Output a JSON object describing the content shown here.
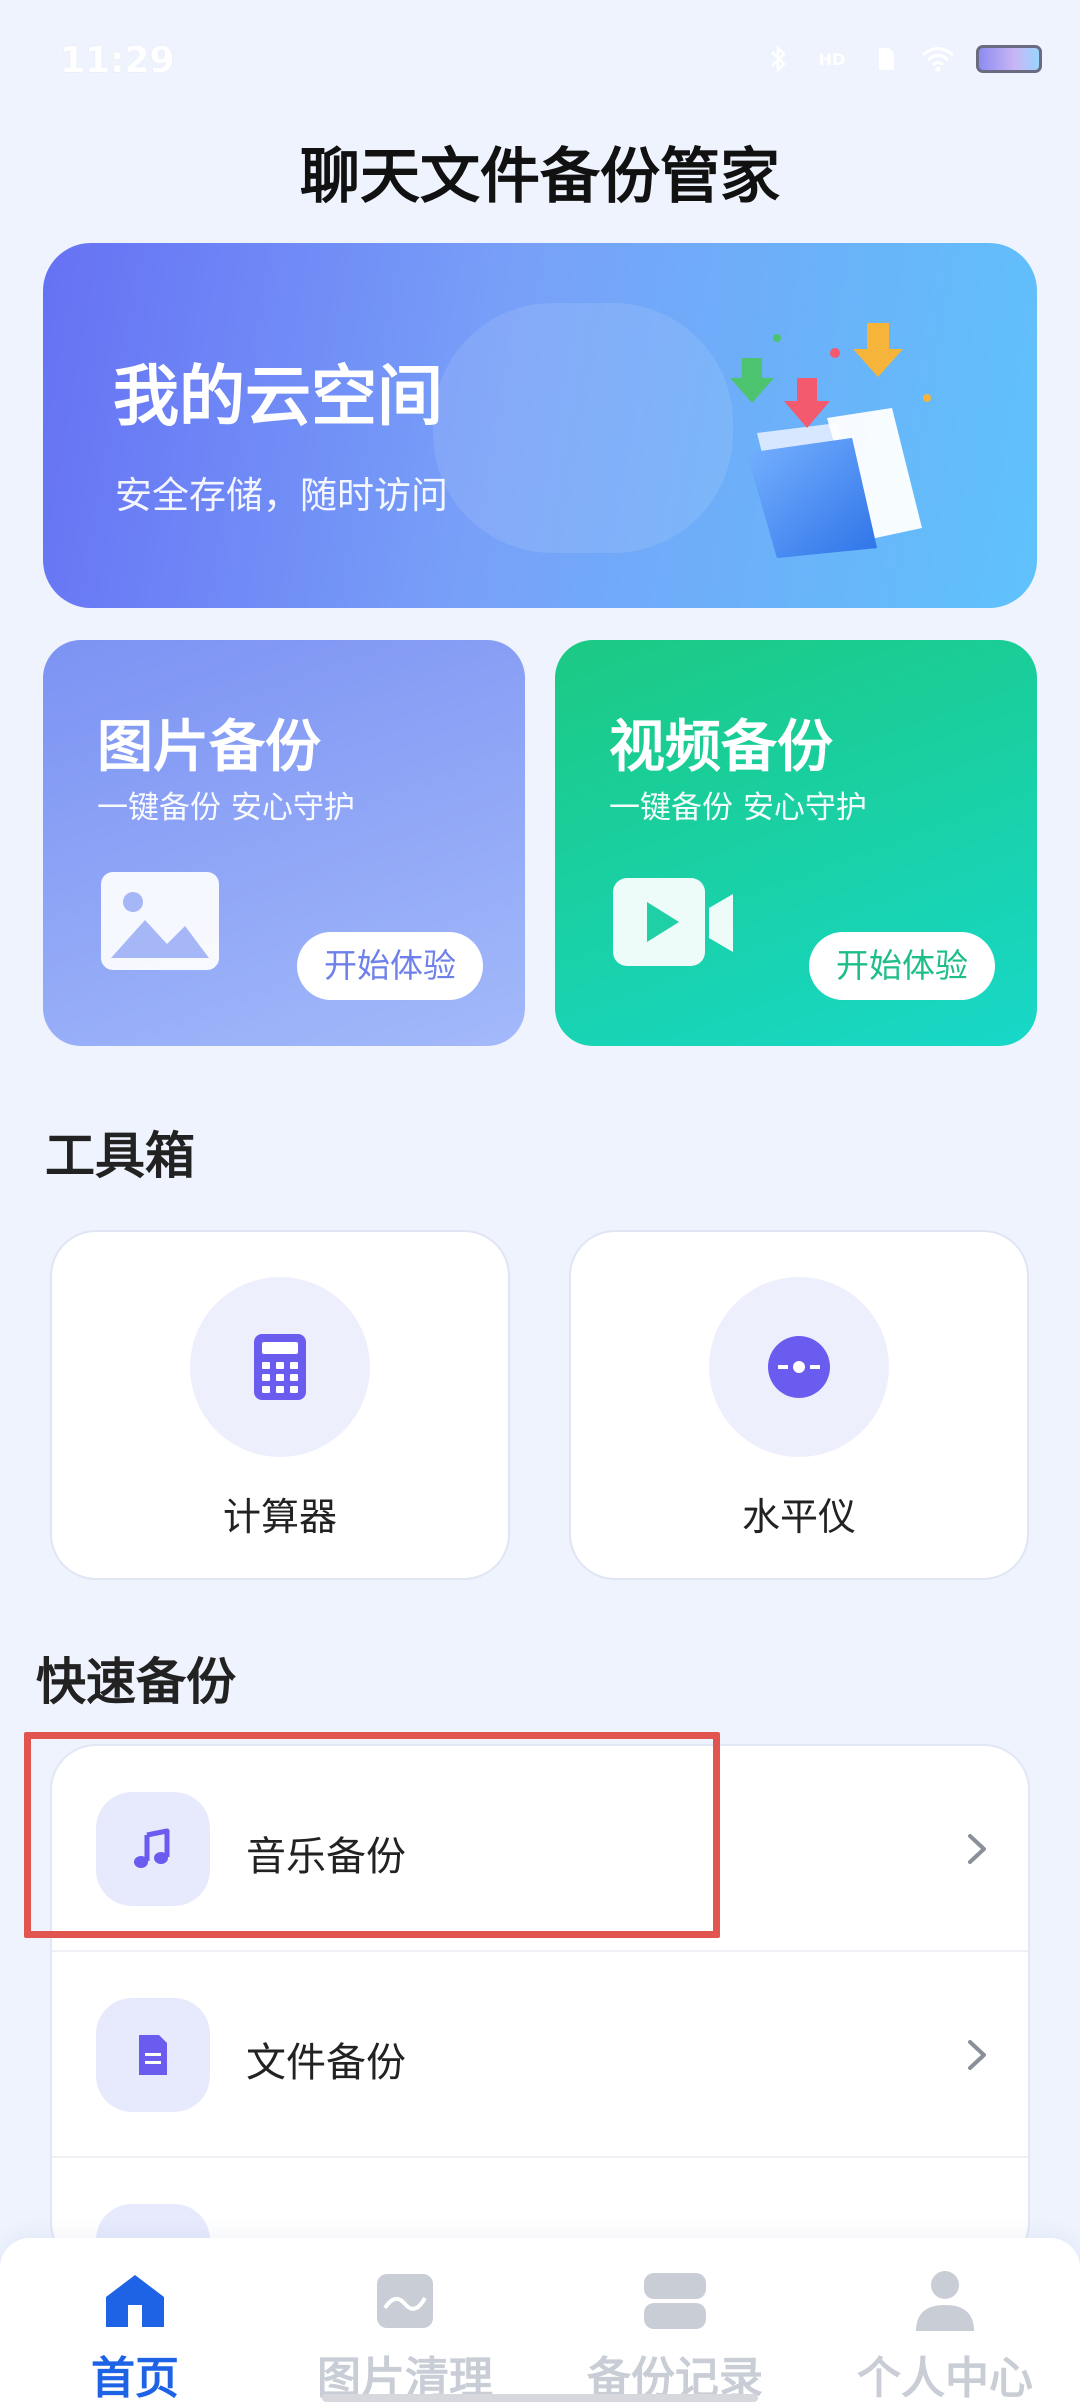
{
  "status_bar": {
    "time": "11:29",
    "network_label": "HD",
    "colors": {
      "time": "#ffffff"
    }
  },
  "app": {
    "title": "聊天文件备份管家"
  },
  "banner": {
    "title": "我的云空间",
    "subtitle": "安全存储，随时访问",
    "icon": "folder-download-icon"
  },
  "feature_cards": [
    {
      "title": "图片备份",
      "subtitle": "一键备份 安心守护",
      "button": "开始体验",
      "icon": "image-icon"
    },
    {
      "title": "视频备份",
      "subtitle": "一键备份 安心守护",
      "button": "开始体验",
      "icon": "video-icon"
    }
  ],
  "toolbox": {
    "title": "工具箱",
    "items": [
      {
        "label": "计算器",
        "icon": "calculator-icon"
      },
      {
        "label": "水平仪",
        "icon": "level-icon"
      }
    ]
  },
  "quick_backup": {
    "title": "快速备份",
    "items": [
      {
        "label": "音乐备份",
        "icon": "music-icon"
      },
      {
        "label": "文件备份",
        "icon": "file-icon"
      }
    ]
  },
  "bottom_nav": {
    "items": [
      {
        "label": "首页",
        "icon": "home-icon",
        "active": true
      },
      {
        "label": "图片清理",
        "icon": "picture-clean-icon",
        "active": false
      },
      {
        "label": "备份记录",
        "icon": "backup-record-icon",
        "active": false
      },
      {
        "label": "个人中心",
        "icon": "person-icon",
        "active": false
      }
    ]
  },
  "colors": {
    "accent": "#1E63E6",
    "tool_icon": "#6B5CF0",
    "highlight_box": "#E25450"
  }
}
